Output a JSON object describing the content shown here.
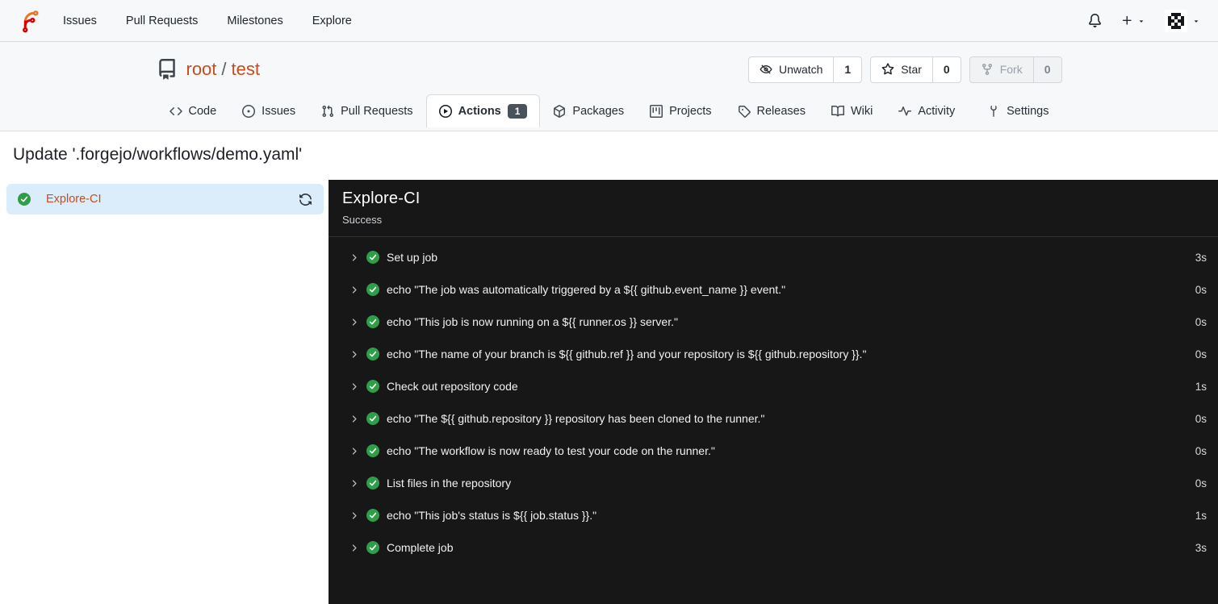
{
  "colors": {
    "accent_link": "#c64c20",
    "success_green": "#2f9e48",
    "panel_bg": "#171717",
    "selected_job_bg": "#dbedfb",
    "header_bg": "#f7f8f9",
    "badge_bg": "#49525b"
  },
  "navbar": {
    "links": [
      {
        "id": "issues",
        "label": "Issues"
      },
      {
        "id": "pull-requests",
        "label": "Pull Requests"
      },
      {
        "id": "milestones",
        "label": "Milestones"
      },
      {
        "id": "explore",
        "label": "Explore"
      }
    ],
    "right": {
      "bell_icon": "bell-icon",
      "create_new_icon": "plus-icon",
      "avatar_icon": "avatar-identicon"
    }
  },
  "repo": {
    "owner": "root",
    "separator": "/",
    "name": "test",
    "buttons": [
      {
        "id": "unwatch",
        "label": "Unwatch",
        "icon": "eye-slash",
        "count": "1",
        "disabled": false
      },
      {
        "id": "star",
        "label": "Star",
        "icon": "star",
        "count": "0",
        "disabled": false
      },
      {
        "id": "fork",
        "label": "Fork",
        "icon": "fork",
        "count": "0",
        "disabled": true
      }
    ],
    "tabs": [
      {
        "id": "code",
        "label": "Code",
        "icon": "code",
        "active": false
      },
      {
        "id": "issues",
        "label": "Issues",
        "icon": "issue",
        "active": false
      },
      {
        "id": "pull-requests",
        "label": "Pull Requests",
        "icon": "pr",
        "active": false
      },
      {
        "id": "actions",
        "label": "Actions",
        "icon": "play",
        "badge": "1",
        "active": true
      },
      {
        "id": "packages",
        "label": "Packages",
        "icon": "package",
        "active": false
      },
      {
        "id": "projects",
        "label": "Projects",
        "icon": "project",
        "active": false
      },
      {
        "id": "releases",
        "label": "Releases",
        "icon": "tag",
        "active": false
      },
      {
        "id": "wiki",
        "label": "Wiki",
        "icon": "book",
        "active": false
      },
      {
        "id": "activity",
        "label": "Activity",
        "icon": "pulse",
        "active": false
      },
      {
        "id": "settings",
        "label": "Settings",
        "icon": "tools",
        "active": false,
        "align": "right"
      }
    ]
  },
  "run": {
    "title": "Update '.forgejo/workflows/demo.yaml'",
    "job": {
      "name": "Explore-CI",
      "status": "Success"
    },
    "steps": [
      {
        "name": "Set up job",
        "duration": "3s"
      },
      {
        "name": "echo \"The job was automatically triggered by a ${{ github.event_name }} event.\"",
        "duration": "0s"
      },
      {
        "name": "echo \"This job is now running on a ${{ runner.os }} server.\"",
        "duration": "0s"
      },
      {
        "name": "echo \"The name of your branch is ${{ github.ref }} and your repository is ${{ github.repository }}.\"",
        "duration": "0s"
      },
      {
        "name": "Check out repository code",
        "duration": "1s"
      },
      {
        "name": "echo \"The ${{ github.repository }} repository has been cloned to the runner.\"",
        "duration": "0s"
      },
      {
        "name": "echo \"The workflow is now ready to test your code on the runner.\"",
        "duration": "0s"
      },
      {
        "name": "List files in the repository",
        "duration": "0s"
      },
      {
        "name": "echo \"This job's status is ${{ job.status }}.\"",
        "duration": "1s"
      },
      {
        "name": "Complete job",
        "duration": "3s"
      }
    ]
  }
}
